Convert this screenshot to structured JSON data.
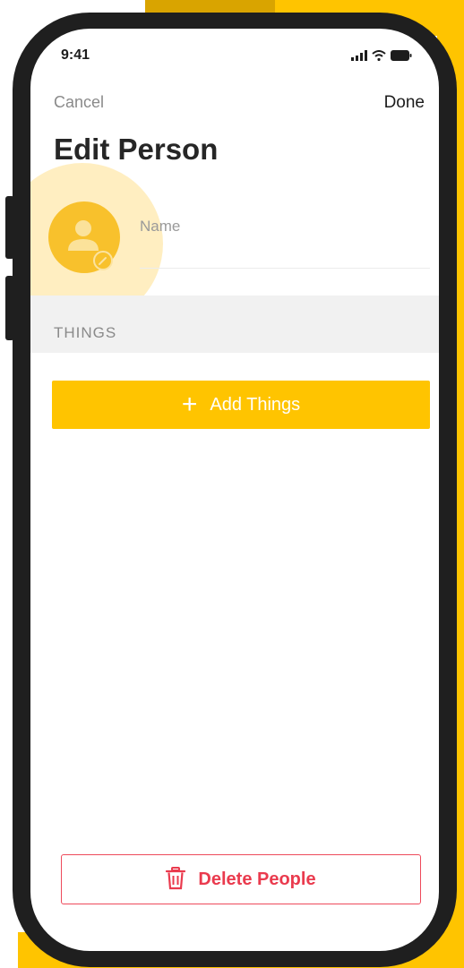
{
  "colors": {
    "accent": "#FFC400",
    "avatar": "#F8C12C",
    "danger": "#EA3B4E",
    "phone_frame": "#1F1F1F"
  },
  "status_bar": {
    "time": "9:41",
    "icons": [
      "signal-icon",
      "wifi-icon",
      "battery-icon"
    ]
  },
  "nav": {
    "cancel_label": "Cancel",
    "done_label": "Done"
  },
  "page": {
    "title": "Edit Person"
  },
  "profile": {
    "avatar_icon": "person-icon",
    "edit_icon": "pencil-icon",
    "name_placeholder": "Name",
    "name_value": ""
  },
  "things_section": {
    "header": "THINGS",
    "add_icon": "plus-icon",
    "add_label": "Add Things"
  },
  "footer": {
    "delete_icon": "trash-icon",
    "delete_label": "Delete People"
  }
}
